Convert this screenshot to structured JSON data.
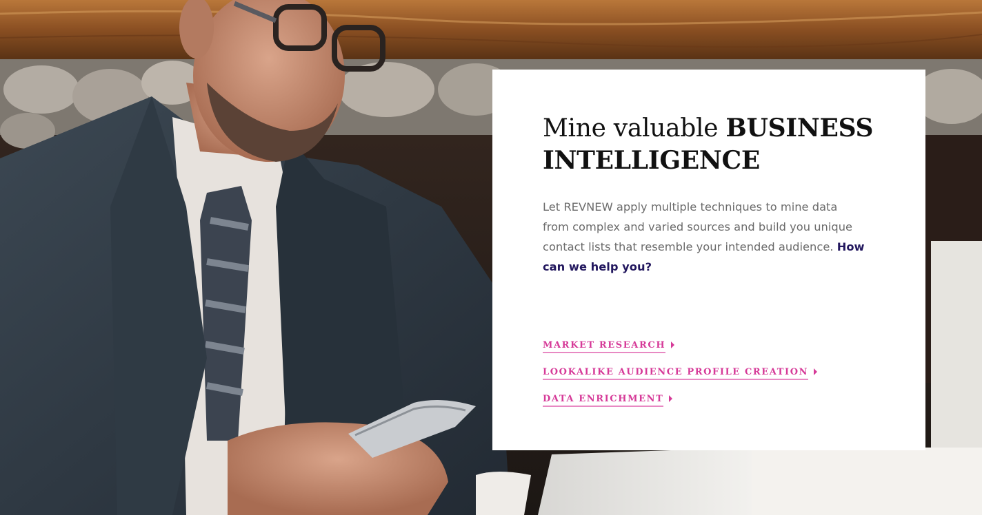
{
  "hero": {
    "photo_alt": "Businessman in suit looking at his phone",
    "heading_light": "Mine valuable ",
    "heading_bold": "BUSINESS INTELLIGENCE",
    "body": "Let REVNEW apply multiple techniques to mine data from complex and varied sources and build you unique contact lists that resemble your intended audience. ",
    "cta": "How can we help you?"
  },
  "links": [
    {
      "label": "MARKET RESEARCH",
      "icon": "caret-right-icon"
    },
    {
      "label": "LOOKALIKE AUDIENCE PROFILE CREATION",
      "icon": "caret-right-icon"
    },
    {
      "label": "DATA ENRICHMENT",
      "icon": "caret-right-icon"
    }
  ],
  "colors": {
    "link_pink": "#d63a98",
    "cta_navy": "#22175e",
    "body_gray": "#6b6b6b"
  }
}
